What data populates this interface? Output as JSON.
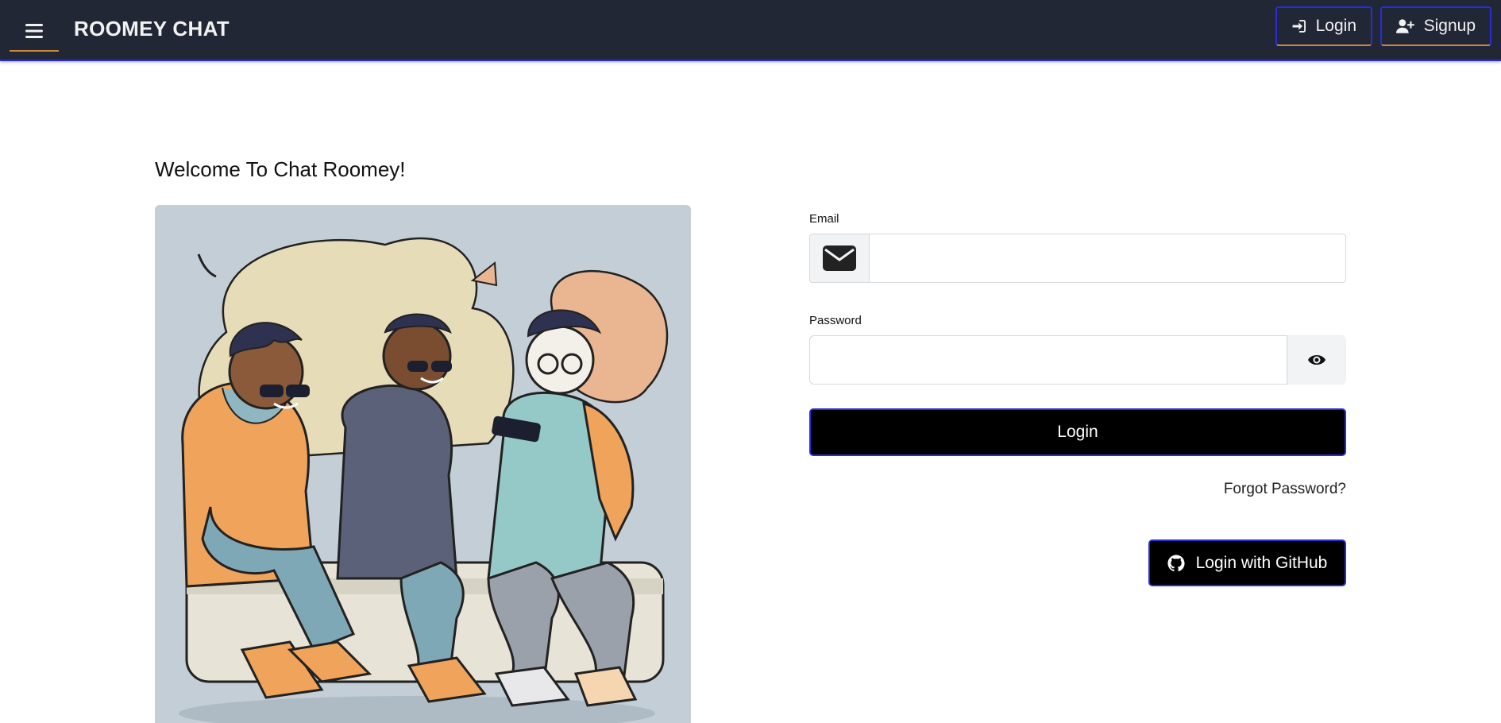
{
  "navbar": {
    "brand": "ROOMEY CHAT",
    "menu_icon": "hamburger-menu-icon",
    "login_label": "Login",
    "login_icon": "sign-in-icon",
    "signup_label": "Signup",
    "signup_icon": "user-plus-icon",
    "background": "#222736",
    "accent": "#2b2bd8"
  },
  "main": {
    "welcome": "Welcome To Chat Roomey!",
    "illustration_alt": "three friends sitting together looking at phones and tablet"
  },
  "form": {
    "email_label": "Email",
    "email_icon": "envelope-icon",
    "email_value": "",
    "password_label": "Password",
    "password_value": "",
    "password_toggle_icon": "eye-icon",
    "login_button": "Login",
    "forgot_password": "Forgot Password?",
    "github_button": "Login with GitHub",
    "github_icon": "github-icon"
  }
}
